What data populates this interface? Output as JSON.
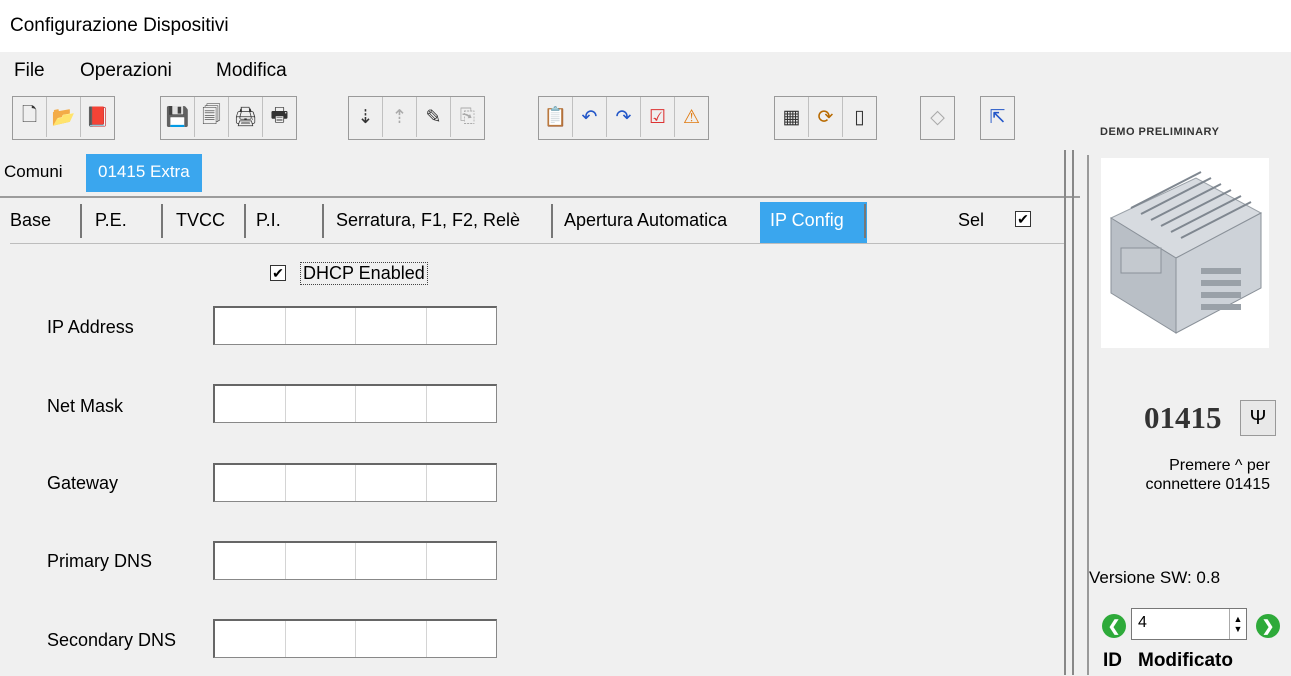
{
  "window": {
    "title": "Configurazione Dispositivi"
  },
  "menu": [
    "File",
    "Operazioni",
    "Modifica"
  ],
  "toolbar": {
    "groups": [
      [
        "new-icon",
        "open-icon",
        "close-doc-icon"
      ],
      [
        "save-icon",
        "save-all-icon",
        "print-icon",
        "print-preview-icon"
      ],
      [
        "import-icon",
        "export-icon",
        "edit-icon",
        "copy-icon"
      ],
      [
        "paste-icon",
        "undo-icon",
        "redo-icon",
        "check-icon",
        "alert-icon"
      ],
      [
        "calendar-icon",
        "sync-icon",
        "device-icon"
      ],
      [
        "tag-icon"
      ],
      [
        "exit-icon"
      ]
    ],
    "glyphs": [
      "🗋",
      "📂",
      "📕",
      "💾",
      "🗐",
      "🖨",
      "🖶",
      "⇣",
      "⇡",
      "✎",
      "⎘",
      "📋",
      "↶",
      "↷",
      "☑",
      "⚠",
      "▦",
      "⟳",
      "▯",
      "◇",
      "⇱"
    ]
  },
  "tabs_top": [
    {
      "label": "Comuni",
      "active": false
    },
    {
      "label": "01415 Extra",
      "active": true
    }
  ],
  "tabs_sub": [
    {
      "label": "Base",
      "active": false
    },
    {
      "label": "P.E.",
      "active": false
    },
    {
      "label": "TVCC",
      "active": false
    },
    {
      "label": "P.I.",
      "active": false
    },
    {
      "label": "Serratura, F1, F2, Relè",
      "active": false
    },
    {
      "label": "Apertura Automatica",
      "active": false
    },
    {
      "label": "IP Config",
      "active": true
    }
  ],
  "sel": {
    "label": "Sel",
    "checked": true
  },
  "dhcp": {
    "label": "DHCP Enabled",
    "checked": true
  },
  "fields": {
    "ip_address": {
      "label": "IP Address",
      "value": ""
    },
    "net_mask": {
      "label": "Net Mask",
      "value": ""
    },
    "gateway": {
      "label": "Gateway",
      "value": ""
    },
    "primary_dns": {
      "label": "Primary DNS",
      "value": ""
    },
    "secondary_dns": {
      "label": "Secondary DNS",
      "value": ""
    }
  },
  "sidebar": {
    "watermark": "DEMO PRELIMINARY",
    "device_code": "01415",
    "hint_line1": "Premere ^ per",
    "hint_line2": "connettere 01415",
    "version": "Versione SW: 0.8",
    "id_value": "4",
    "id_label": "ID",
    "status": "Modificato"
  },
  "colors": {
    "accent": "#3aa6ee",
    "nav_green": "#2eaa3a"
  }
}
